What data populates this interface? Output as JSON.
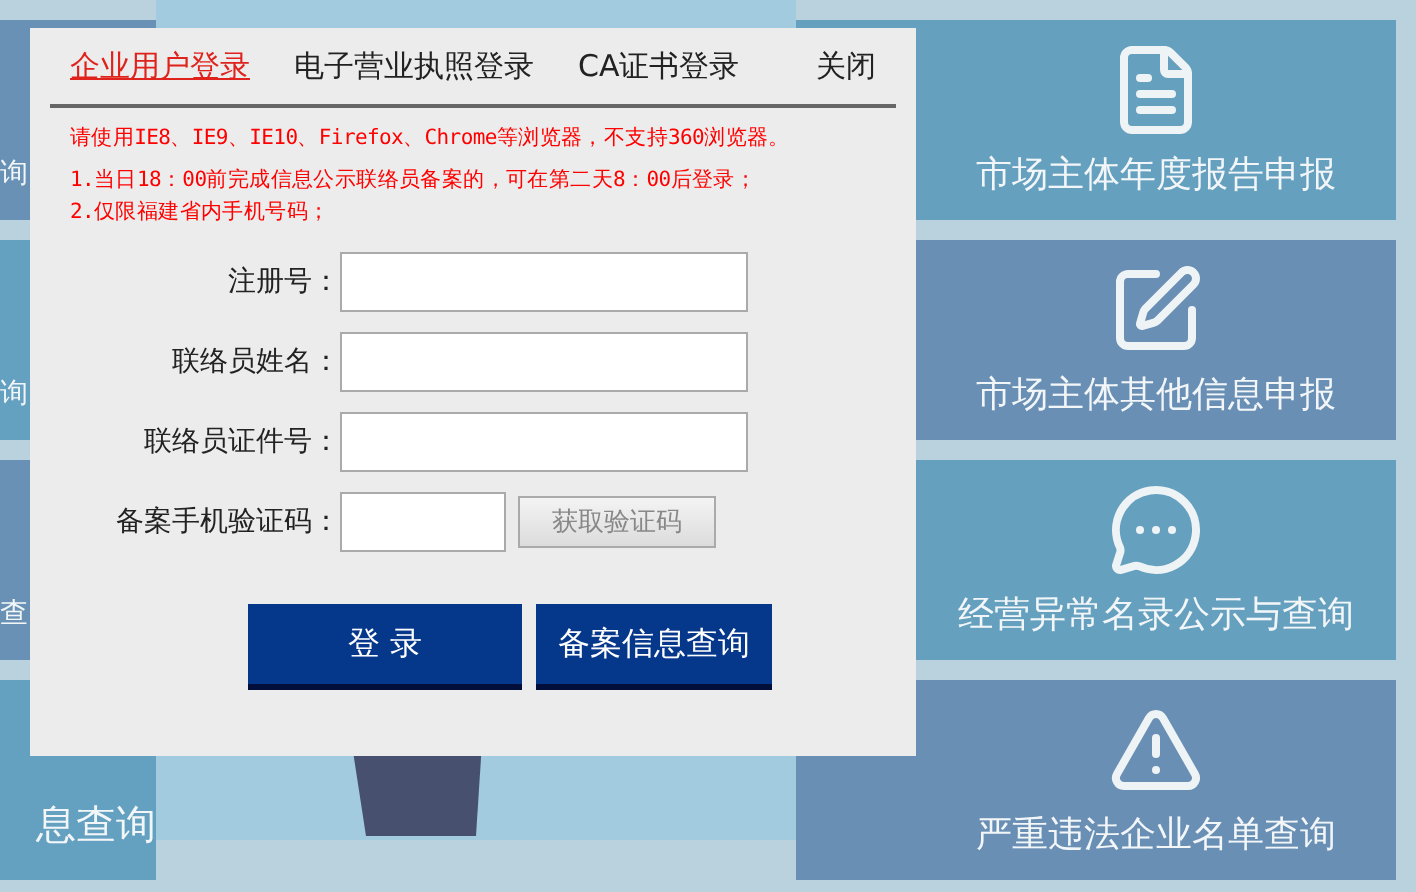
{
  "left_tiles": [
    {
      "label": "询"
    },
    {
      "label": "询"
    },
    {
      "label": "查"
    },
    {
      "label": "息查询"
    }
  ],
  "tiles": [
    {
      "label": "市场主体年度报告申报",
      "kind": "document"
    },
    {
      "label": "市场主体其他信息申报",
      "kind": "pen"
    },
    {
      "label": "经营异常名录公示与查询",
      "kind": "chat"
    },
    {
      "label": "严重违法企业名单查询",
      "kind": "warning"
    }
  ],
  "dialog": {
    "tabs": [
      {
        "label": "企业用户登录",
        "selected": true
      },
      {
        "label": "电子营业执照登录",
        "selected": false
      },
      {
        "label": "CA证书登录",
        "selected": false
      }
    ],
    "close_label": "关闭",
    "notice": "请使用IE8、IE9、IE10、Firefox、Chrome等浏览器，不支持360浏览器。",
    "notes": [
      "1.当日18：00前完成信息公示联络员备案的，可在第二天8：00后登录；",
      "2.仅限福建省内手机号码；"
    ],
    "fields": [
      {
        "label": "注册号：",
        "kind": "text"
      },
      {
        "label": "联络员姓名：",
        "kind": "text"
      },
      {
        "label": "联络员证件号：",
        "kind": "text"
      },
      {
        "label": "备案手机验证码：",
        "kind": "code",
        "button": "获取验证码"
      }
    ],
    "buttons": [
      "登 录",
      "备案信息查询"
    ]
  }
}
